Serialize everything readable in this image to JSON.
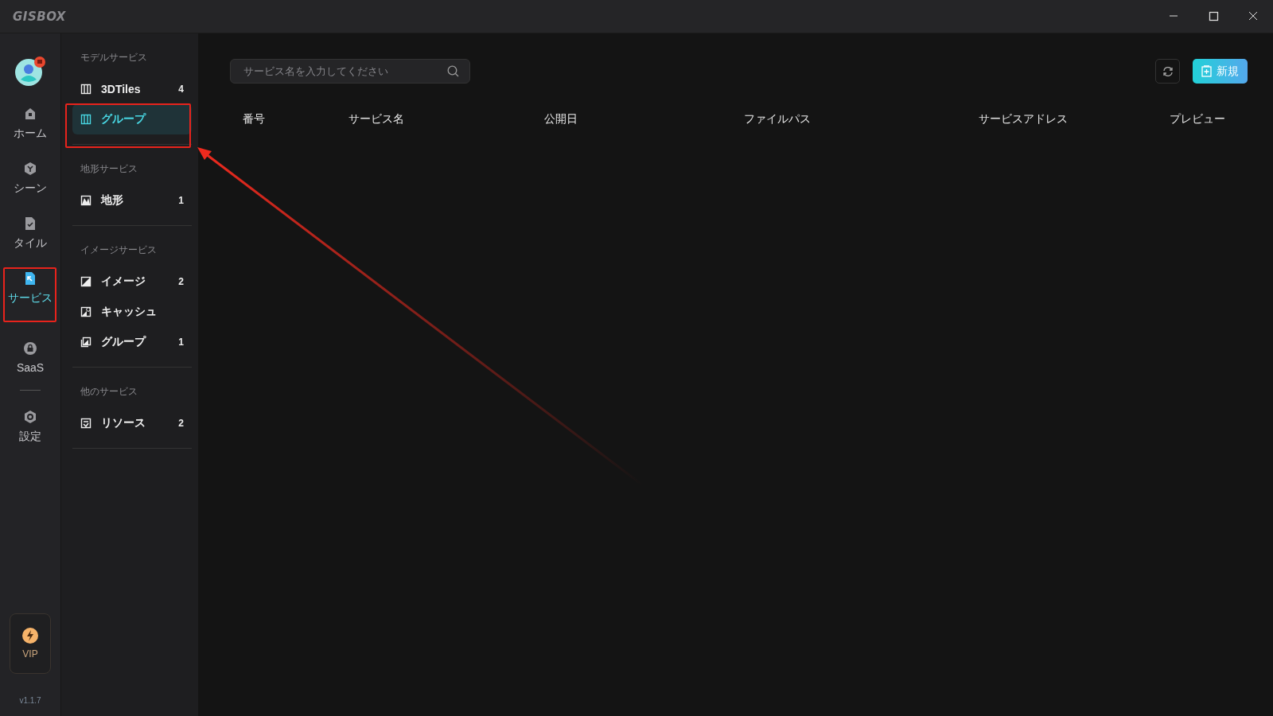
{
  "titlebar": {
    "logo": "GISBOX"
  },
  "rail": {
    "groups": [
      [
        {
          "label": "ホーム",
          "selected": false
        },
        {
          "label": "シーン",
          "selected": false
        },
        {
          "label": "タイル",
          "selected": false
        },
        {
          "label": "サービス",
          "selected": true
        }
      ],
      [
        {
          "label": "SaaS",
          "selected": false
        }
      ],
      [
        {
          "label": "設定",
          "selected": false
        }
      ]
    ],
    "vip": "VIP",
    "version": "v1.1.7"
  },
  "service_menu": {
    "groups": [
      {
        "heading": "モデルサービス",
        "items": [
          {
            "label": "3DTiles",
            "count": "4",
            "selected": false
          },
          {
            "label": "グループ",
            "selected": true
          }
        ]
      },
      {
        "heading": "地形サービス",
        "items": [
          {
            "label": "地形",
            "count": "1",
            "selected": false
          }
        ]
      },
      {
        "heading": "イメージサービス",
        "items": [
          {
            "label": "イメージ",
            "count": "2",
            "selected": false
          },
          {
            "label": "キャッシュ",
            "selected": false
          },
          {
            "label": "グループ",
            "count": "1",
            "selected": false
          }
        ]
      },
      {
        "heading": "他のサービス",
        "items": [
          {
            "label": "リソース",
            "count": "2",
            "selected": false
          }
        ]
      }
    ]
  },
  "search": {
    "placeholder": "サービス名を入力してください"
  },
  "new_button": "新規",
  "table": {
    "columns": [
      "番号",
      "サービス名",
      "公開日",
      "ファイルパス",
      "サービスアドレス",
      "プレビュー"
    ]
  }
}
